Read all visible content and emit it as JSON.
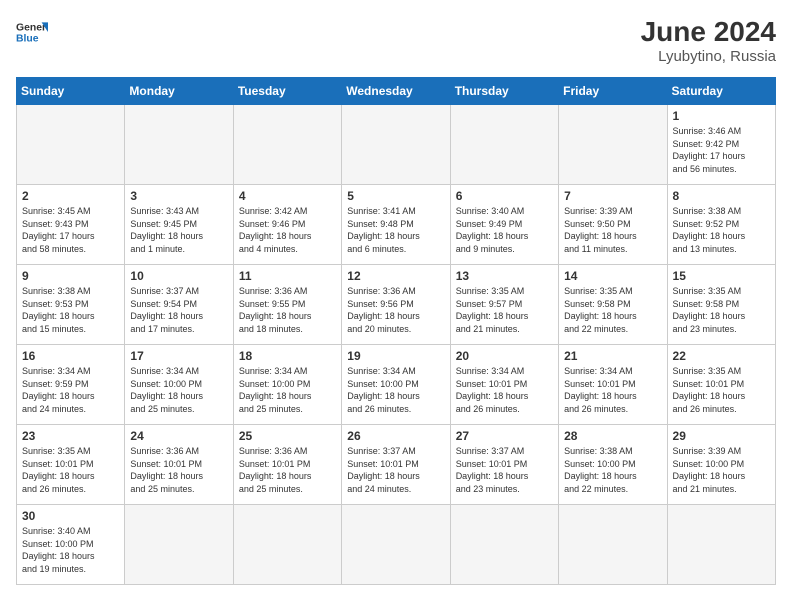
{
  "header": {
    "logo_general": "General",
    "logo_blue": "Blue",
    "month_year": "June 2024",
    "location": "Lyubytino, Russia"
  },
  "weekdays": [
    "Sunday",
    "Monday",
    "Tuesday",
    "Wednesday",
    "Thursday",
    "Friday",
    "Saturday"
  ],
  "days": {
    "1": {
      "sunrise": "3:46 AM",
      "sunset": "9:42 PM",
      "daylight": "17 hours and 56 minutes."
    },
    "2": {
      "sunrise": "3:45 AM",
      "sunset": "9:43 PM",
      "daylight": "17 hours and 58 minutes."
    },
    "3": {
      "sunrise": "3:43 AM",
      "sunset": "9:45 PM",
      "daylight": "18 hours and 1 minute."
    },
    "4": {
      "sunrise": "3:42 AM",
      "sunset": "9:46 PM",
      "daylight": "18 hours and 4 minutes."
    },
    "5": {
      "sunrise": "3:41 AM",
      "sunset": "9:48 PM",
      "daylight": "18 hours and 6 minutes."
    },
    "6": {
      "sunrise": "3:40 AM",
      "sunset": "9:49 PM",
      "daylight": "18 hours and 9 minutes."
    },
    "7": {
      "sunrise": "3:39 AM",
      "sunset": "9:50 PM",
      "daylight": "18 hours and 11 minutes."
    },
    "8": {
      "sunrise": "3:38 AM",
      "sunset": "9:52 PM",
      "daylight": "18 hours and 13 minutes."
    },
    "9": {
      "sunrise": "3:38 AM",
      "sunset": "9:53 PM",
      "daylight": "18 hours and 15 minutes."
    },
    "10": {
      "sunrise": "3:37 AM",
      "sunset": "9:54 PM",
      "daylight": "18 hours and 17 minutes."
    },
    "11": {
      "sunrise": "3:36 AM",
      "sunset": "9:55 PM",
      "daylight": "18 hours and 18 minutes."
    },
    "12": {
      "sunrise": "3:36 AM",
      "sunset": "9:56 PM",
      "daylight": "18 hours and 20 minutes."
    },
    "13": {
      "sunrise": "3:35 AM",
      "sunset": "9:57 PM",
      "daylight": "18 hours and 21 minutes."
    },
    "14": {
      "sunrise": "3:35 AM",
      "sunset": "9:58 PM",
      "daylight": "18 hours and 22 minutes."
    },
    "15": {
      "sunrise": "3:35 AM",
      "sunset": "9:58 PM",
      "daylight": "18 hours and 23 minutes."
    },
    "16": {
      "sunrise": "3:34 AM",
      "sunset": "9:59 PM",
      "daylight": "18 hours and 24 minutes."
    },
    "17": {
      "sunrise": "3:34 AM",
      "sunset": "10:00 PM",
      "daylight": "18 hours and 25 minutes."
    },
    "18": {
      "sunrise": "3:34 AM",
      "sunset": "10:00 PM",
      "daylight": "18 hours and 25 minutes."
    },
    "19": {
      "sunrise": "3:34 AM",
      "sunset": "10:00 PM",
      "daylight": "18 hours and 26 minutes."
    },
    "20": {
      "sunrise": "3:34 AM",
      "sunset": "10:01 PM",
      "daylight": "18 hours and 26 minutes."
    },
    "21": {
      "sunrise": "3:34 AM",
      "sunset": "10:01 PM",
      "daylight": "18 hours and 26 minutes."
    },
    "22": {
      "sunrise": "3:35 AM",
      "sunset": "10:01 PM",
      "daylight": "18 hours and 26 minutes."
    },
    "23": {
      "sunrise": "3:35 AM",
      "sunset": "10:01 PM",
      "daylight": "18 hours and 26 minutes."
    },
    "24": {
      "sunrise": "3:36 AM",
      "sunset": "10:01 PM",
      "daylight": "18 hours and 25 minutes."
    },
    "25": {
      "sunrise": "3:36 AM",
      "sunset": "10:01 PM",
      "daylight": "18 hours and 25 minutes."
    },
    "26": {
      "sunrise": "3:37 AM",
      "sunset": "10:01 PM",
      "daylight": "18 hours and 24 minutes."
    },
    "27": {
      "sunrise": "3:37 AM",
      "sunset": "10:01 PM",
      "daylight": "18 hours and 23 minutes."
    },
    "28": {
      "sunrise": "3:38 AM",
      "sunset": "10:00 PM",
      "daylight": "18 hours and 22 minutes."
    },
    "29": {
      "sunrise": "3:39 AM",
      "sunset": "10:00 PM",
      "daylight": "18 hours and 21 minutes."
    },
    "30": {
      "sunrise": "3:40 AM",
      "sunset": "10:00 PM",
      "daylight": "18 hours and 19 minutes."
    }
  },
  "labels": {
    "sunrise": "Sunrise:",
    "sunset": "Sunset:",
    "daylight": "Daylight:"
  }
}
